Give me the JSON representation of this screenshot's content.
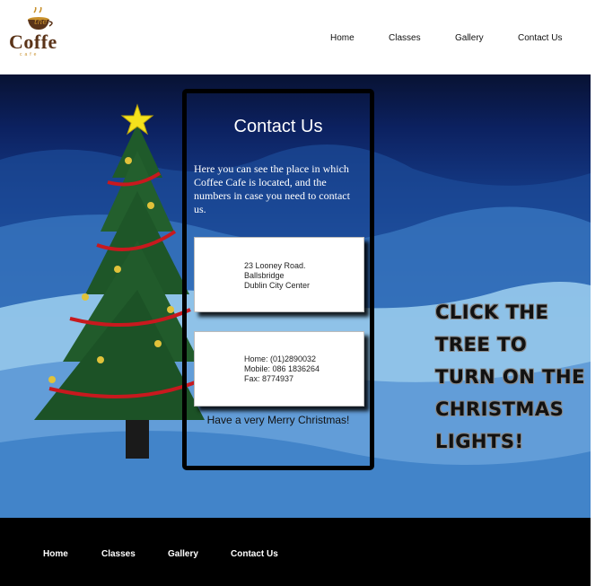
{
  "logo": {
    "small_text": "the",
    "word": "Coffe",
    "sub_text": "cafe"
  },
  "nav": {
    "items": [
      {
        "label": "Home"
      },
      {
        "label": "Classes"
      },
      {
        "label": "Gallery"
      },
      {
        "label": "Contact Us"
      }
    ]
  },
  "contact": {
    "title": "Contact Us",
    "description": "Here you can see the place in which Coffee Cafe is located, and the numbers in case you need to contact us.",
    "address": [
      "23 Looney Road.",
      "Ballsbridge",
      "Dublin City Center"
    ],
    "phones": [
      "Home: (01)2890032",
      "Mobile: 086 1836264",
      "Fax: 8774937"
    ],
    "greeting": "Have a very Merry Christmas!"
  },
  "promo": {
    "lines": [
      "Click the",
      "tree to",
      "turn on the",
      "Christmas",
      "lights!"
    ]
  },
  "footer": {
    "items": [
      {
        "label": "Home"
      },
      {
        "label": "Classes"
      },
      {
        "label": "Gallery"
      },
      {
        "label": "Contact Us"
      }
    ]
  },
  "colors": {
    "logo_brown": "#5a3318",
    "logo_gold": "#c8902b",
    "footer_bg": "#000000",
    "panel_border": "#000000"
  },
  "icons": {
    "logo": "coffee-cup-icon",
    "tree": "christmas-tree",
    "star": "star-icon"
  }
}
